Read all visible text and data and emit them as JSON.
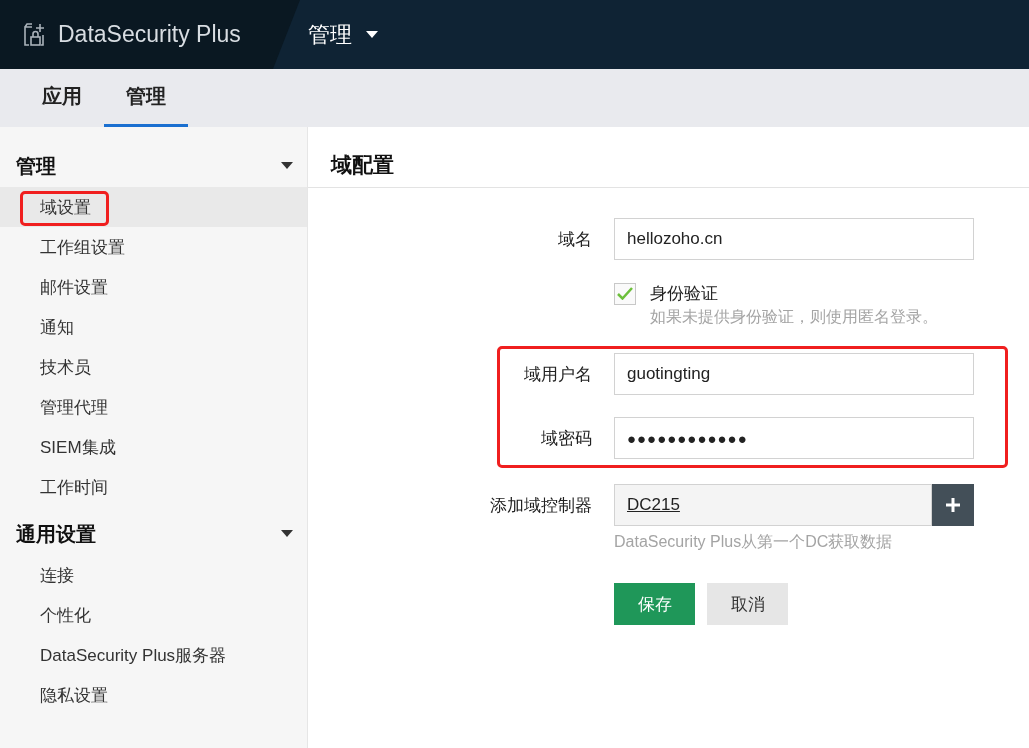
{
  "header": {
    "product": "DataSecurity Plus",
    "module_menu": "管理"
  },
  "tabs": [
    {
      "label": "应用",
      "selected": false
    },
    {
      "label": "管理",
      "selected": true
    }
  ],
  "sidebar": {
    "sections": [
      {
        "title": "管理",
        "expanded": true,
        "items": [
          {
            "label": "域设置",
            "selected": true,
            "annotated": true
          },
          {
            "label": "工作组设置",
            "selected": false,
            "annotated": false
          },
          {
            "label": "邮件设置",
            "selected": false,
            "annotated": false
          },
          {
            "label": "通知",
            "selected": false,
            "annotated": false
          },
          {
            "label": "技术员",
            "selected": false,
            "annotated": false
          },
          {
            "label": "管理代理",
            "selected": false,
            "annotated": false
          },
          {
            "label": "SIEM集成",
            "selected": false,
            "annotated": false
          },
          {
            "label": "工作时间",
            "selected": false,
            "annotated": false
          }
        ]
      },
      {
        "title": "通用设置",
        "expanded": true,
        "items": [
          {
            "label": "连接",
            "selected": false,
            "annotated": false
          },
          {
            "label": "个性化",
            "selected": false,
            "annotated": false
          },
          {
            "label": "DataSecurity Plus服务器",
            "selected": false,
            "annotated": false
          },
          {
            "label": "隐私设置",
            "selected": false,
            "annotated": false
          }
        ]
      }
    ]
  },
  "page_title": "域配置",
  "form": {
    "domain": {
      "label": "域名",
      "value": "hellozoho.cn"
    },
    "auth": {
      "label": "身份验证",
      "checked": true,
      "hint": "如果未提供身份验证，则使用匿名登录。"
    },
    "credentials": {
      "annotated": true,
      "fields": [
        {
          "kind": "text",
          "label": "域用户名",
          "value": "guotingting"
        },
        {
          "kind": "password",
          "label": "域密码",
          "value": "●●●●●●●●●●●●"
        }
      ]
    },
    "controller": {
      "label": "添加域控制器",
      "value": "DC215",
      "hint": "DataSecurity Plus从第一个DC获取数据"
    },
    "buttons": [
      {
        "kind": "primary",
        "label": "保存"
      },
      {
        "kind": "secondary",
        "label": "取消"
      }
    ]
  }
}
